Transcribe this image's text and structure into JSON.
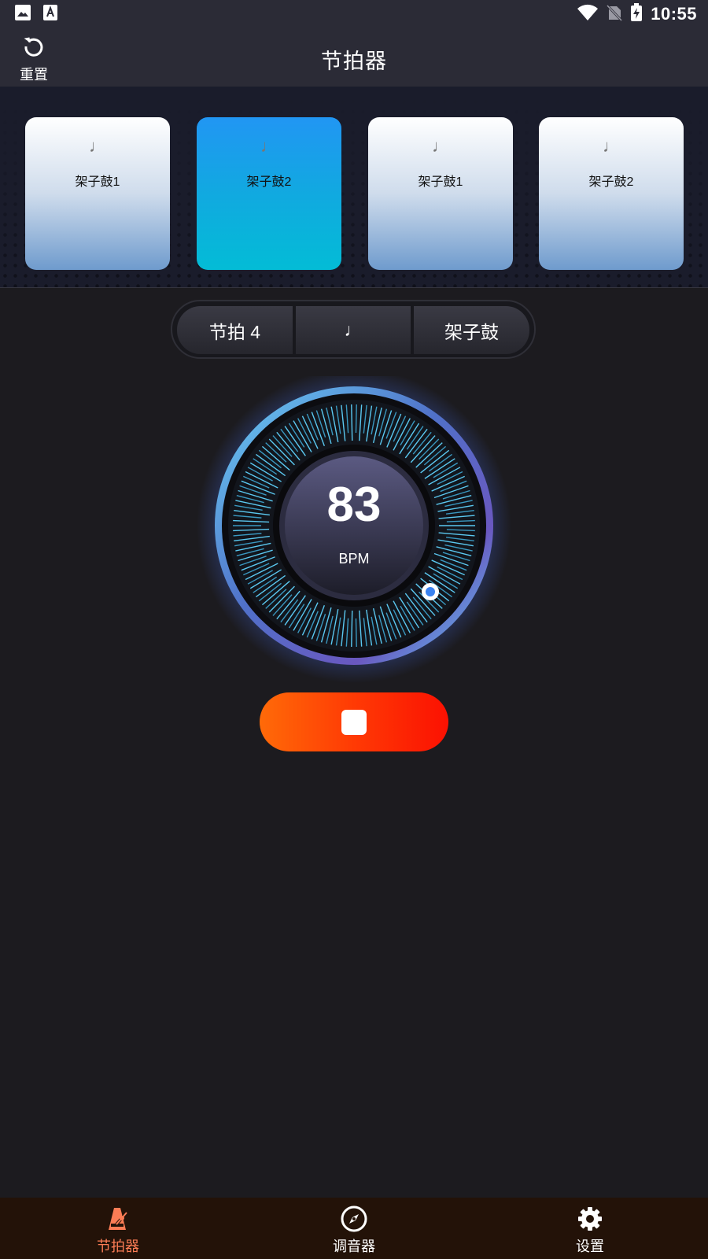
{
  "status_bar": {
    "time": "10:55"
  },
  "app_bar": {
    "reset_label": "重置",
    "title": "节拍器"
  },
  "beats": [
    {
      "label": "架子鼓1",
      "active": false
    },
    {
      "label": "架子鼓2",
      "active": true
    },
    {
      "label": "架子鼓1",
      "active": false
    },
    {
      "label": "架子鼓2",
      "active": false
    }
  ],
  "beat_note_glyph": "♩",
  "selector": {
    "beats": "节拍 4",
    "note": "♩",
    "sound": "架子鼓"
  },
  "tempo": {
    "value": "83",
    "unit": "BPM"
  },
  "bottom_nav": [
    {
      "label": "节拍器",
      "icon": "metronome-icon",
      "active": true
    },
    {
      "label": "调音器",
      "icon": "compass-icon",
      "active": false
    },
    {
      "label": "设置",
      "icon": "gear-icon",
      "active": false
    }
  ],
  "colors": {
    "accent": "#fb7c55",
    "active_beat": "#1e9bef",
    "stop_button": "#ff3a04",
    "dial_ring": "#5bc8f0"
  }
}
